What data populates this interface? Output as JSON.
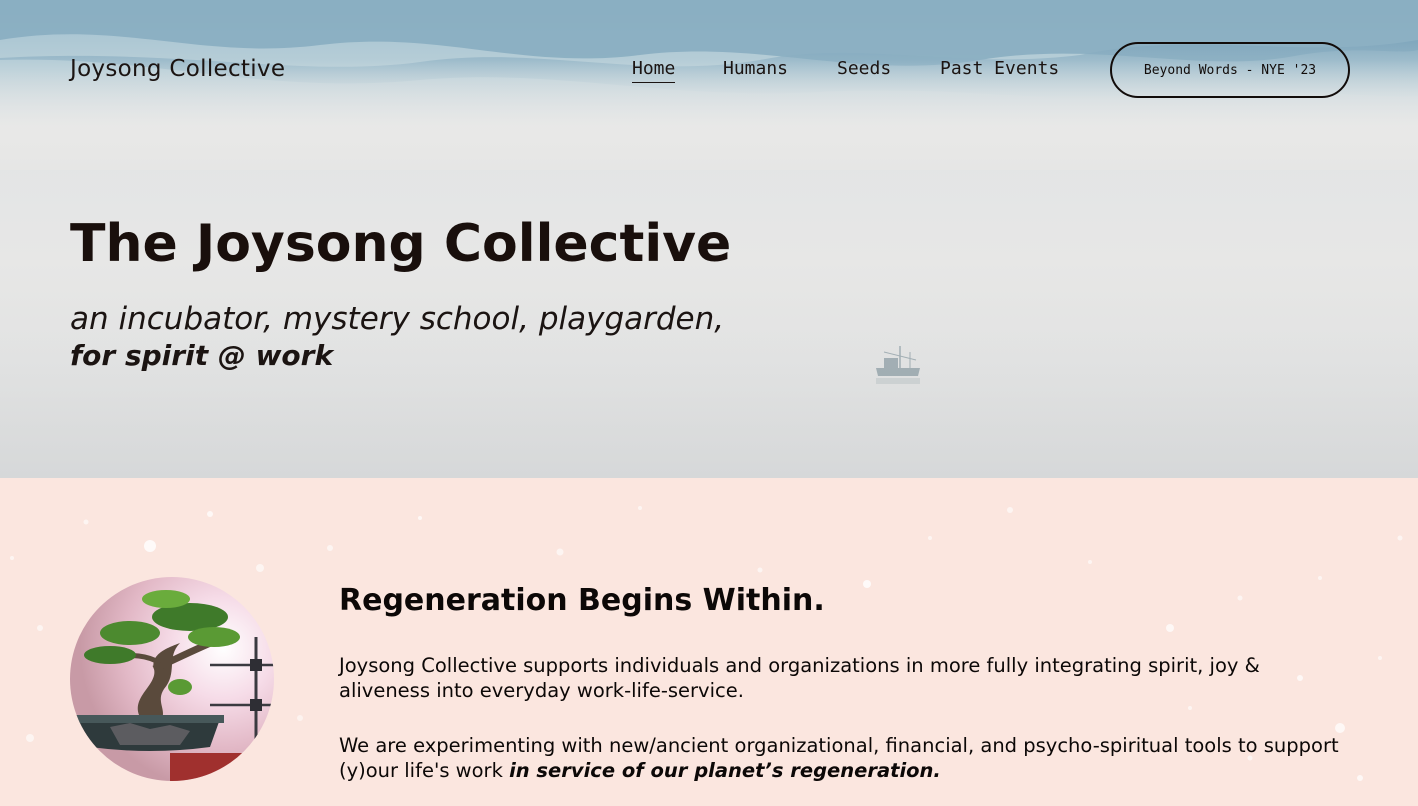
{
  "header": {
    "logo": "Joysong Collective",
    "nav": [
      {
        "label": "Home",
        "active": true
      },
      {
        "label": "Humans",
        "active": false
      },
      {
        "label": "Seeds",
        "active": false
      },
      {
        "label": "Past Events",
        "active": false
      }
    ],
    "cta_label": "Beyond Words - NYE '23"
  },
  "hero": {
    "title": "The Joysong Collective",
    "subtitle": "an incubator, mystery school, playgarden,",
    "subtitle_bold": "for spirit @ work"
  },
  "section": {
    "title": "Regeneration Begins Within.",
    "paragraph1": "Joysong Collective supports individuals and organizations in more fully integrating spirit, joy & aliveness into everyday work-life-service.",
    "paragraph2_lead": "We are experimenting with new/ancient organizational, financial, and psycho-spiritual tools to support (y)our life's work ",
    "paragraph2_emphasis": "in service of our planet’s regeneration."
  },
  "colors": {
    "hero_sky": "#9fbfcf",
    "hero_mist": "#e4e4e4",
    "section_bg": "#fbe6df",
    "text": "#160e0c"
  }
}
